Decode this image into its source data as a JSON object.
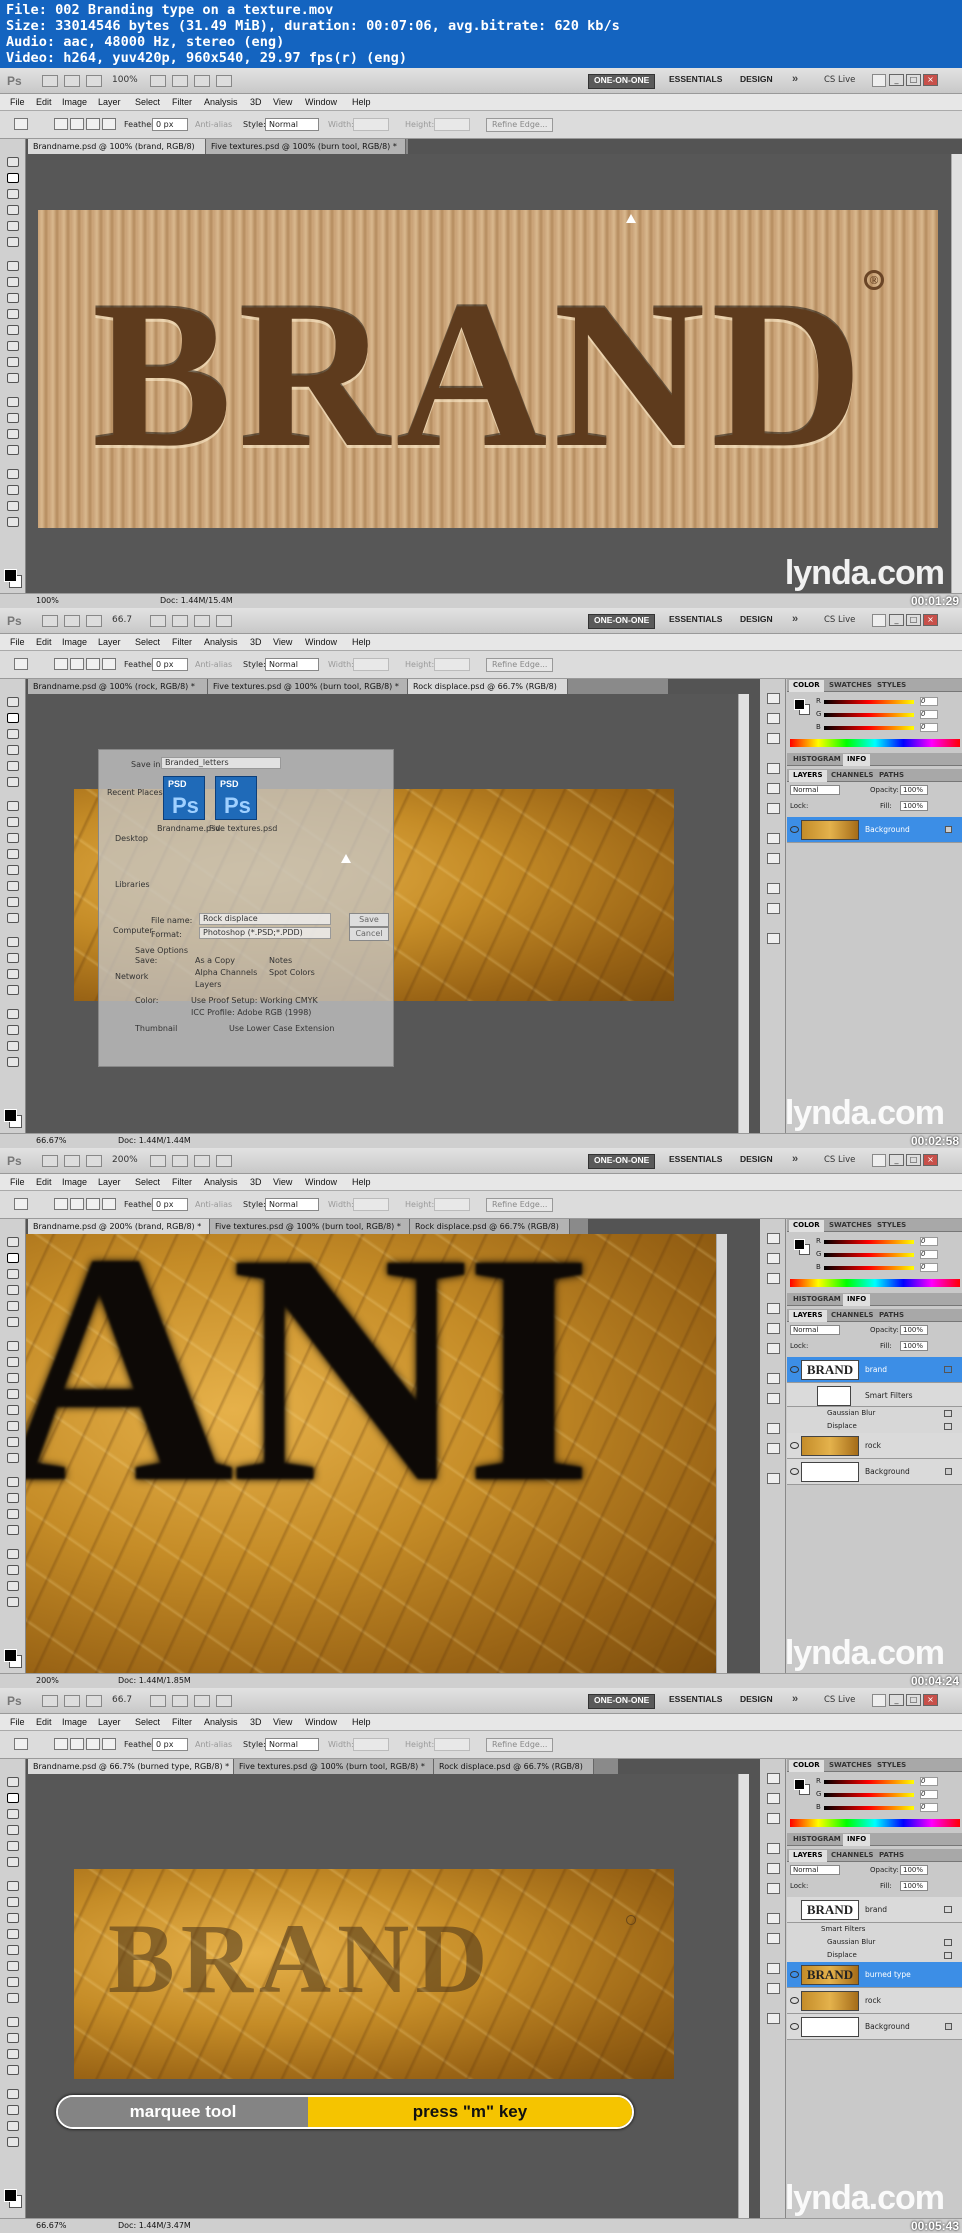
{
  "header": {
    "file": "File: 002 Branding type on a texture.mov",
    "size": "Size: 33014546 bytes (31.49 MiB), duration: 00:07:06, avg.bitrate: 620 kb/s",
    "audio": "Audio: aac, 48000 Hz, stereo (eng)",
    "video": "Video: h264, yuv420p, 960x540, 29.97 fps(r) (eng)"
  },
  "app": {
    "logo": "Ps",
    "workspaces": [
      "ONE-ON-ONE",
      "ESSENTIALS",
      "DESIGN"
    ],
    "more": "»",
    "cs_live": "CS Live",
    "menu": [
      "File",
      "Edit",
      "Image",
      "Layer",
      "Select",
      "Filter",
      "Analysis",
      "3D",
      "View",
      "Window",
      "Help"
    ],
    "options": {
      "feather_label": "Feather:",
      "feather_value": "0 px",
      "anti_alias": "Anti-alias",
      "style_label": "Style:",
      "style_value": "Normal",
      "width_label": "Width:",
      "height_label": "Height:",
      "refine": "Refine Edge..."
    },
    "watermark": "lynda.com"
  },
  "panels": {
    "color_tabs": [
      "COLOR",
      "SWATCHES",
      "STYLES"
    ],
    "mid_tabs": [
      "HISTOGRAM",
      "INFO"
    ],
    "layer_tabs": [
      "LAYERS",
      "CHANNELS",
      "PATHS"
    ],
    "blend_mode": "Normal",
    "opacity_label": "Opacity:",
    "opacity_value": "100%",
    "lock_label": "Lock:",
    "fill_label": "Fill:",
    "fill_value": "100%",
    "color_rows": [
      {
        "label": "R",
        "value": "0"
      },
      {
        "label": "G",
        "value": "0"
      },
      {
        "label": "B",
        "value": "0"
      }
    ]
  },
  "frames": [
    {
      "zoom": "100%",
      "tabs": [
        "Brandname.psd @ 100% (brand, RGB/8)",
        "Five textures.psd @ 100% (burn tool, RGB/8) *"
      ],
      "artwork_text": "BRAND",
      "registered": "®",
      "status_zoom": "100%",
      "status_doc": "Doc: 1.44M/15.4M",
      "timestamp": "00:01:29"
    },
    {
      "zoom": "66.7",
      "tabs": [
        "Brandname.psd @ 100% (rock, RGB/8) *",
        "Five textures.psd @ 100% (burn tool, RGB/8) *",
        "Rock displace.psd @ 66.7% (RGB/8)"
      ],
      "dialog": {
        "save_in_label": "Save in:",
        "save_in_value": "Branded_letters",
        "places": [
          "Recent Places",
          "Desktop",
          "Libraries",
          "Computer",
          "Network"
        ],
        "files": [
          "Brandname.psd",
          "Five textures.psd"
        ],
        "file_icon": "PSD",
        "file_icon_glyph": "Ps",
        "file_name_label": "File name:",
        "file_name_value": "Rock displace",
        "format_label": "Format:",
        "format_value": "Photoshop (*.PSD;*.PDD)",
        "save_options": "Save Options",
        "save_label": "Save:",
        "as_copy": "As a Copy",
        "notes": "Notes",
        "alpha": "Alpha Channels",
        "spot": "Spot Colors",
        "layers": "Layers",
        "color_label": "Color:",
        "proof": "Use Proof Setup:  Working CMYK",
        "icc": "ICC Profile:  Adobe RGB (1998)",
        "thumbnail": "Thumbnail",
        "lower_case": "Use Lower Case Extension",
        "save_btn": "Save",
        "cancel_btn": "Cancel"
      },
      "layers": [
        {
          "name": "Background",
          "selected": true
        }
      ],
      "status_zoom": "66.67%",
      "status_doc": "Doc: 1.44M/1.44M",
      "timestamp": "00:02:58"
    },
    {
      "zoom": "200%",
      "tabs": [
        "Brandname.psd @ 200% (brand, RGB/8) *",
        "Five textures.psd @ 100% (burn tool, RGB/8) *",
        "Rock displace.psd @ 66.7% (RGB/8)"
      ],
      "artwork_text": "ANI",
      "layers": [
        {
          "name": "brand",
          "selected": true
        },
        {
          "name": "Smart Filters"
        },
        {
          "name": "Gaussian Blur"
        },
        {
          "name": "Displace"
        },
        {
          "name": "rock"
        },
        {
          "name": "Background"
        }
      ],
      "status_zoom": "200%",
      "status_doc": "Doc: 1.44M/1.85M",
      "timestamp": "00:04:24"
    },
    {
      "zoom": "66.7",
      "tabs": [
        "Brandname.psd @ 66.7% (burned type, RGB/8) *",
        "Five textures.psd @ 100% (burn tool, RGB/8) *",
        "Rock displace.psd @ 66.7% (RGB/8)"
      ],
      "artwork_text": "BRAND",
      "layers": [
        {
          "name": "brand"
        },
        {
          "name": "Smart Filters"
        },
        {
          "name": "Gaussian Blur"
        },
        {
          "name": "Displace"
        },
        {
          "name": "burned type",
          "selected": true
        },
        {
          "name": "rock"
        },
        {
          "name": "Background"
        }
      ],
      "lower_third": {
        "tool": "marquee tool",
        "shortcut": "press \"m\" key"
      },
      "status_zoom": "66.67%",
      "status_doc": "Doc: 1.44M/3.47M",
      "timestamp": "00:05:43"
    }
  ]
}
